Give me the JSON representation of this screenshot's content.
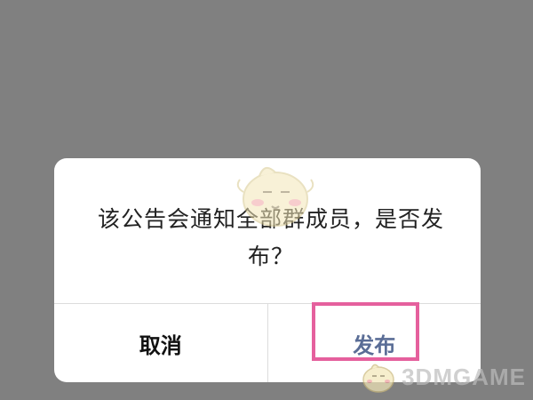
{
  "dialog": {
    "message": "该公告会通知全部群成员，是否发布？",
    "cancel_label": "取消",
    "publish_label": "发布"
  },
  "watermark": {
    "text": "3DMGAME"
  },
  "colors": {
    "overlay": "#808080",
    "dialog_bg": "#ffffff",
    "primary_action": "#5a6d96",
    "highlight": "#e5609d"
  }
}
